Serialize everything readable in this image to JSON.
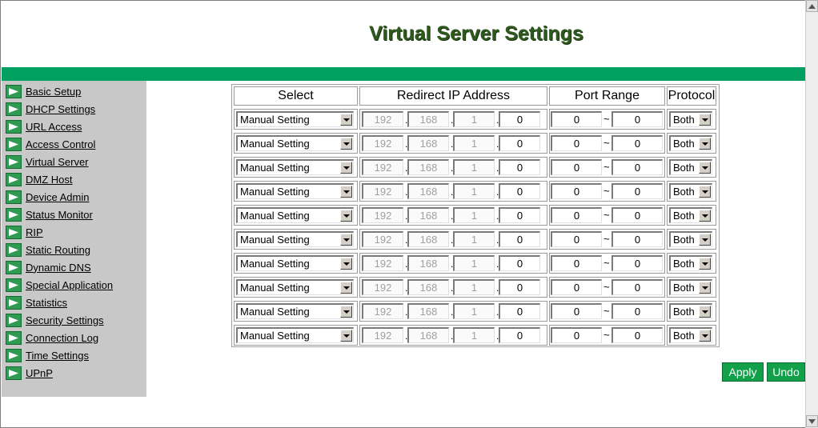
{
  "page": {
    "title": "Virtual Server Settings"
  },
  "sidebar": {
    "items": [
      {
        "label": "Basic Setup"
      },
      {
        "label": "DHCP Settings"
      },
      {
        "label": "URL Access"
      },
      {
        "label": "Access Control"
      },
      {
        "label": "Virtual Server"
      },
      {
        "label": "DMZ Host"
      },
      {
        "label": "Device Admin"
      },
      {
        "label": "Status Monitor"
      },
      {
        "label": "RIP"
      },
      {
        "label": "Static Routing"
      },
      {
        "label": "Dynamic DNS"
      },
      {
        "label": "Special Application"
      },
      {
        "label": "Statistics"
      },
      {
        "label": "Security Settings"
      },
      {
        "label": "Connection Log"
      },
      {
        "label": "Time Settings"
      },
      {
        "label": "UPnP"
      }
    ]
  },
  "table": {
    "headers": {
      "select": "Select",
      "redirect_ip": "Redirect IP Address",
      "port_range": "Port Range",
      "protocol": "Protocol"
    },
    "rows": [
      {
        "select": "Manual Setting",
        "ip": [
          "192",
          "168",
          "1",
          "0"
        ],
        "port_from": "0",
        "port_sep": "~",
        "port_to": "0",
        "protocol": "Both"
      },
      {
        "select": "Manual Setting",
        "ip": [
          "192",
          "168",
          "1",
          "0"
        ],
        "port_from": "0",
        "port_sep": "~",
        "port_to": "0",
        "protocol": "Both"
      },
      {
        "select": "Manual Setting",
        "ip": [
          "192",
          "168",
          "1",
          "0"
        ],
        "port_from": "0",
        "port_sep": "~",
        "port_to": "0",
        "protocol": "Both"
      },
      {
        "select": "Manual Setting",
        "ip": [
          "192",
          "168",
          "1",
          "0"
        ],
        "port_from": "0",
        "port_sep": "~",
        "port_to": "0",
        "protocol": "Both"
      },
      {
        "select": "Manual Setting",
        "ip": [
          "192",
          "168",
          "1",
          "0"
        ],
        "port_from": "0",
        "port_sep": "~",
        "port_to": "0",
        "protocol": "Both"
      },
      {
        "select": "Manual Setting",
        "ip": [
          "192",
          "168",
          "1",
          "0"
        ],
        "port_from": "0",
        "port_sep": "~",
        "port_to": "0",
        "protocol": "Both"
      },
      {
        "select": "Manual Setting",
        "ip": [
          "192",
          "168",
          "1",
          "0"
        ],
        "port_from": "0",
        "port_sep": "~",
        "port_to": "0",
        "protocol": "Both"
      },
      {
        "select": "Manual Setting",
        "ip": [
          "192",
          "168",
          "1",
          "0"
        ],
        "port_from": "0",
        "port_sep": "~",
        "port_to": "0",
        "protocol": "Both"
      },
      {
        "select": "Manual Setting",
        "ip": [
          "192",
          "168",
          "1",
          "0"
        ],
        "port_from": "0",
        "port_sep": "~",
        "port_to": "0",
        "protocol": "Both"
      },
      {
        "select": "Manual Setting",
        "ip": [
          "192",
          "168",
          "1",
          "0"
        ],
        "port_from": "0",
        "port_sep": "~",
        "port_to": "0",
        "protocol": "Both"
      }
    ]
  },
  "buttons": {
    "apply": "Apply",
    "undo": "Undo"
  },
  "colors": {
    "accent_green": "#00a060",
    "button_green": "#12a04a",
    "sidebar_gray": "#c8c8c8",
    "title_green": "#2f5a1e"
  },
  "icons": {
    "nav_arrow": "arrow-right-icon",
    "dropdown": "chevron-down-icon"
  }
}
